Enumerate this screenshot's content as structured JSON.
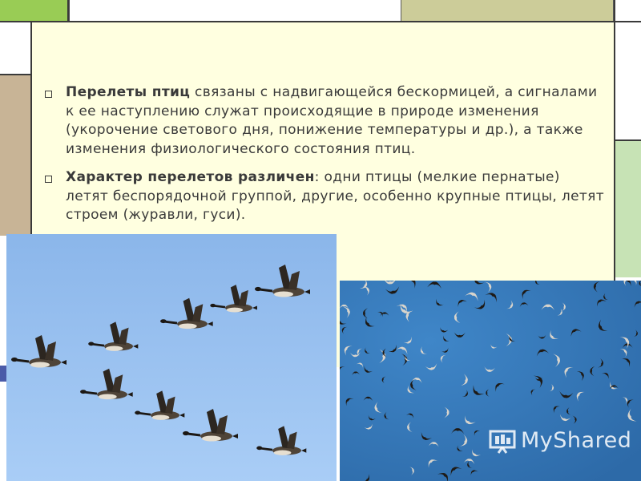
{
  "slide": {
    "paragraphs": [
      {
        "bold": "Перелеты птиц",
        "text": " связаны с надвигающейся бескормицей, а сигналами к ее наступлению служат происходящие в природе изменения (укорочение светового дня, понижение температуры и др.), а также изменения физиологического состояния птиц."
      },
      {
        "bold": "Характер перелетов различен",
        "text": ": одни птицы (мелкие пернатые) летят беспорядочной группой, другие, особенно крупные птицы, летят строем (журавли, гуси)."
      }
    ]
  },
  "images": {
    "geese_photo": "geese-flying-in-formation",
    "flock_photo": "scattered-flock-of-small-birds"
  },
  "watermark": {
    "icon": "presentation-board-icon",
    "text": "MyShared"
  },
  "colors": {
    "content_bg": "#ffffe0",
    "accent_green": "#99cc55",
    "accent_olive": "#cccc99",
    "accent_tan": "#c8b496",
    "accent_blue": "#4a5aa8",
    "sky_geese": "#8fb8ec",
    "sky_flock": "#3a78ba",
    "text": "#3a3a3a"
  }
}
